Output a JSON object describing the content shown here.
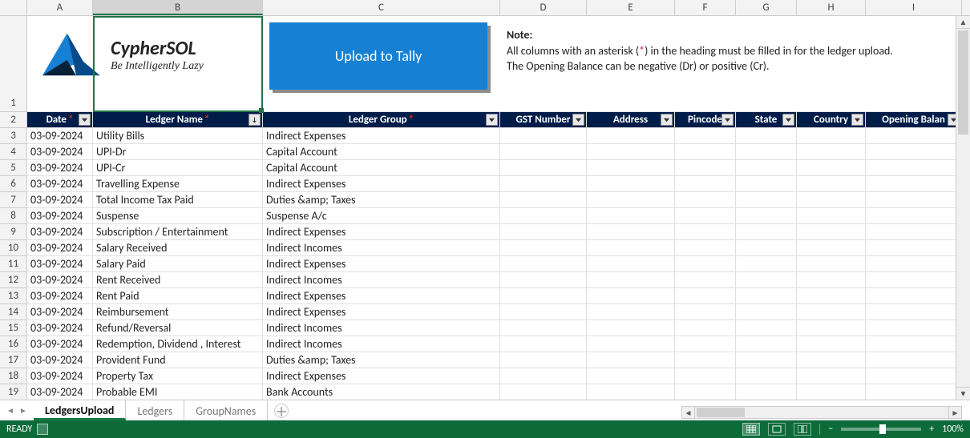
{
  "columns": [
    "A",
    "B",
    "C",
    "D",
    "E",
    "F",
    "G",
    "H",
    "I"
  ],
  "selected_column": "B",
  "logo": {
    "brand_text": "CypherSOL",
    "tagline": "Be Intelligently Lazy"
  },
  "upload_button_label": "Upload to Tally",
  "note": {
    "heading": "Note:",
    "line1_prefix": "All columns with an asterisk (",
    "line1_ast": "*",
    "line1_suffix": ") in the heading must be filled in for the ledger upload.",
    "line2": "The Opening Balance can be negative (Dr) or positive (Cr)."
  },
  "headers": {
    "A": "Date",
    "B": "Ledger Name",
    "C": "Ledger Group",
    "D": "GST Number",
    "E": "Address",
    "F": "Pincode",
    "G": "State",
    "H": "Country",
    "I": "Opening Balan"
  },
  "headers_required": {
    "A": true,
    "B": true,
    "C": true,
    "D": false,
    "E": false,
    "F": false,
    "G": false,
    "H": false,
    "I": false
  },
  "sort_indicator_column": "B",
  "rows": [
    {
      "n": 3,
      "A": "03-09-2024",
      "B": "Utility Bills",
      "C": "Indirect Expenses"
    },
    {
      "n": 4,
      "A": "03-09-2024",
      "B": "UPI-Dr",
      "C": "Capital Account"
    },
    {
      "n": 5,
      "A": "03-09-2024",
      "B": "UPI-Cr",
      "C": "Capital Account"
    },
    {
      "n": 6,
      "A": "03-09-2024",
      "B": "Travelling Expense",
      "C": "Indirect Expenses"
    },
    {
      "n": 7,
      "A": "03-09-2024",
      "B": "Total Income Tax Paid",
      "C": "Duties &amp; Taxes"
    },
    {
      "n": 8,
      "A": "03-09-2024",
      "B": "Suspense",
      "C": "Suspense A/c"
    },
    {
      "n": 9,
      "A": "03-09-2024",
      "B": "Subscription / Entertainment",
      "C": "Indirect Expenses"
    },
    {
      "n": 10,
      "A": "03-09-2024",
      "B": "Salary Received",
      "C": "Indirect Incomes"
    },
    {
      "n": 11,
      "A": "03-09-2024",
      "B": "Salary Paid",
      "C": "Indirect Expenses"
    },
    {
      "n": 12,
      "A": "03-09-2024",
      "B": "Rent Received",
      "C": "Indirect Incomes"
    },
    {
      "n": 13,
      "A": "03-09-2024",
      "B": "Rent Paid",
      "C": "Indirect Expenses"
    },
    {
      "n": 14,
      "A": "03-09-2024",
      "B": "Reimbursement",
      "C": "Indirect Expenses"
    },
    {
      "n": 15,
      "A": "03-09-2024",
      "B": "Refund/Reversal",
      "C": "Indirect Incomes"
    },
    {
      "n": 16,
      "A": "03-09-2024",
      "B": "Redemption, Dividend , Interest",
      "C": "Indirect Incomes"
    },
    {
      "n": 17,
      "A": "03-09-2024",
      "B": "Provident Fund",
      "C": "Duties &amp; Taxes"
    },
    {
      "n": 18,
      "A": "03-09-2024",
      "B": "Property Tax",
      "C": "Indirect Expenses"
    },
    {
      "n": 19,
      "A": "03-09-2024",
      "B": "Probable EMI",
      "C": "Bank Accounts"
    }
  ],
  "sheet_tabs": [
    "LedgersUpload",
    "Ledgers",
    "GroupNames"
  ],
  "active_tab": 0,
  "status": {
    "ready": "READY",
    "zoom": "100%"
  }
}
